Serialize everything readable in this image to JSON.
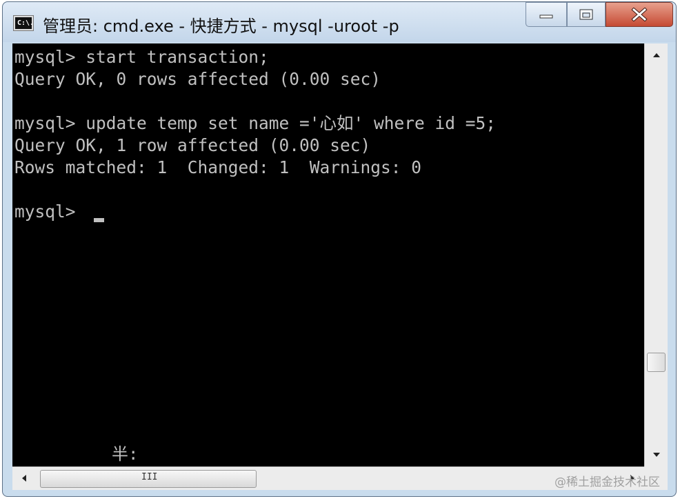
{
  "window": {
    "icon_text": "C:\\.",
    "title": "管理员: cmd.exe - 快捷方式 - mysql  -uroot -p"
  },
  "console": {
    "lines": [
      "mysql> start transaction;",
      "Query OK, 0 rows affected (0.00 sec)",
      "",
      "mysql> update temp set name ='心如' where id =5;",
      "Query OK, 1 row affected (0.00 sec)",
      "Rows matched: 1  Changed: 1  Warnings: 0",
      "",
      "mysql> "
    ],
    "ime_indicator": "半:"
  },
  "scrollbar": {
    "horizontal_grip": "III"
  },
  "watermark": "@稀土掘金技术社区",
  "colors": {
    "console_bg": "#000000",
    "console_fg": "#c0c0c0",
    "close_button": "#c54a33",
    "titlebar": "#c9dced"
  }
}
